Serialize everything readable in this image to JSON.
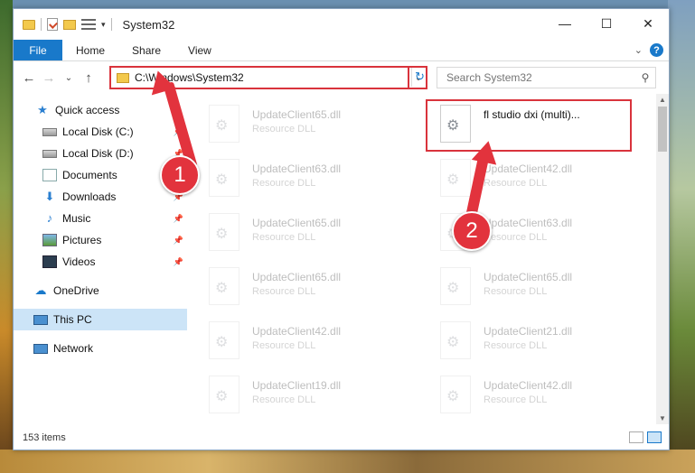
{
  "window": {
    "title": "System32",
    "controls": {
      "minimize": "—",
      "maximize": "☐",
      "close": "✕"
    }
  },
  "ribbon": {
    "file": "File",
    "tabs": [
      "Home",
      "Share",
      "View"
    ],
    "help": "?"
  },
  "nav": {
    "back": "←",
    "forward": "→",
    "recent": "⌄",
    "up": "↑",
    "address": "C:\\Windows\\System32",
    "search_placeholder": "Search System32"
  },
  "sidebar": {
    "items": [
      {
        "label": "Quick access",
        "icon": "star-icon",
        "pinned": false
      },
      {
        "label": "Local Disk (C:)",
        "icon": "drive-icon",
        "pinned": true
      },
      {
        "label": "Local Disk (D:)",
        "icon": "drive-icon",
        "pinned": true
      },
      {
        "label": "Documents",
        "icon": "documents-icon",
        "pinned": true
      },
      {
        "label": "Downloads",
        "icon": "download-icon",
        "pinned": true
      },
      {
        "label": "Music",
        "icon": "music-icon",
        "pinned": true
      },
      {
        "label": "Pictures",
        "icon": "pictures-icon",
        "pinned": true
      },
      {
        "label": "Videos",
        "icon": "videos-icon",
        "pinned": true
      },
      {
        "label": "OneDrive",
        "icon": "cloud-icon",
        "pinned": false
      },
      {
        "label": "This PC",
        "icon": "pc-icon",
        "pinned": false,
        "selected": true
      },
      {
        "label": "Network",
        "icon": "network-icon",
        "pinned": false
      }
    ]
  },
  "files": {
    "left_column": [
      {
        "name": "UpdateClient65.dll",
        "type": "Resource DLL"
      },
      {
        "name": "UpdateClient63.dll",
        "type": "Resource DLL"
      },
      {
        "name": "UpdateClient65.dll",
        "type": "Resource DLL"
      },
      {
        "name": "UpdateClient65.dll",
        "type": "Resource DLL"
      },
      {
        "name": "UpdateClient42.dll",
        "type": "Resource DLL"
      },
      {
        "name": "UpdateClient19.dll",
        "type": "Resource DLL"
      }
    ],
    "right_column": [
      {
        "name": "fl studio dxi (multi)...",
        "type": ""
      },
      {
        "name": "UpdateClient42.dll",
        "type": "Resource DLL"
      },
      {
        "name": "UpdateClient63.dll",
        "type": "Resource DLL"
      },
      {
        "name": "UpdateClient65.dll",
        "type": "Resource DLL"
      },
      {
        "name": "UpdateClient21.dll",
        "type": "Resource DLL"
      },
      {
        "name": "UpdateClient42.dll",
        "type": "Resource DLL"
      }
    ]
  },
  "status": {
    "item_count": "153 items"
  },
  "annotations": {
    "step1": "1",
    "step2": "2",
    "accent": "#e2333d"
  }
}
